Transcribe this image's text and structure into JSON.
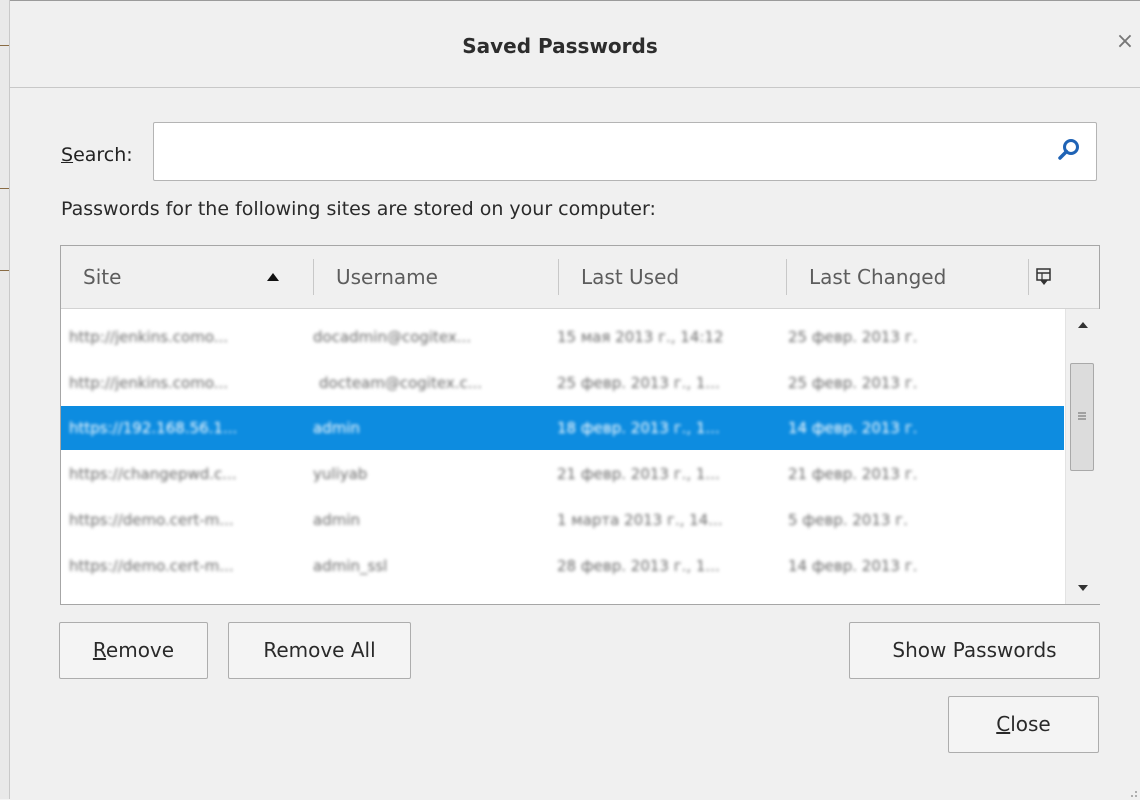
{
  "dialog": {
    "title": "Saved Passwords"
  },
  "search": {
    "label": "Search:",
    "value": ""
  },
  "info_text": "Passwords for the following sites are stored on your computer:",
  "table": {
    "columns": [
      "Site",
      "Username",
      "Last Used",
      "Last Changed"
    ],
    "sort": "ascending",
    "rows": [
      {
        "site": "http://jenkins.como...",
        "username": "docadmin@cogitex...",
        "last_used": "15 мая 2013 г., 14:12",
        "last_changed": "25 февр. 2013 г."
      },
      {
        "site": "http://jenkins.como...",
        "username": "docteam@cogitex.c...",
        "last_used": "25 февр. 2013 г., 1...",
        "last_changed": "25 февр. 2013 г."
      },
      {
        "site": "https://192.168.56.1...",
        "username": "admin",
        "last_used": "18 февр. 2013 г., 1...",
        "last_changed": "14 февр. 2013 г.",
        "selected": true
      },
      {
        "site": "https://changepwd.c...",
        "username": "yuliyab",
        "last_used": "21 февр. 2013 г., 1...",
        "last_changed": "21 февр. 2013 г."
      },
      {
        "site": "https://demo.cert-m...",
        "username": "admin",
        "last_used": "1 марта 2013 г., 14...",
        "last_changed": "5 февр. 2013 г."
      },
      {
        "site": "https://demo.cert-m...",
        "username": "admin_ssl",
        "last_used": "28 февр. 2013 г., 1...",
        "last_changed": "14 февр. 2013 г."
      }
    ]
  },
  "buttons": {
    "remove": "Remove",
    "remove_all": "Remove All",
    "show_passwords": "Show Passwords",
    "close": "Close"
  },
  "colors": {
    "selection": "#0d8ce0",
    "search_icon": "#1f63b5"
  }
}
